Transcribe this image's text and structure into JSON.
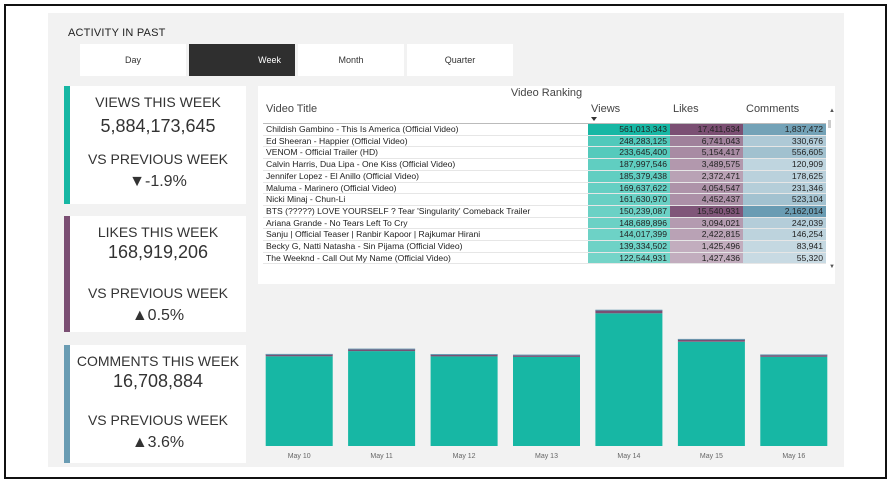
{
  "header": {
    "title": "ACTIVITY IN PAST"
  },
  "tabs": [
    {
      "label": "Day",
      "active": false
    },
    {
      "label": "Week",
      "active": true
    },
    {
      "label": "Month",
      "active": false
    },
    {
      "label": "Quarter",
      "active": false
    }
  ],
  "kpis": {
    "views": {
      "title": "VIEWS THIS WEEK",
      "value": "5,884,173,645",
      "compare_label": "VS PREVIOUS WEEK",
      "change": "▼-1.9%",
      "color": "#17b7a4"
    },
    "likes": {
      "title": "LIKES THIS WEEK",
      "value": "168,919,206",
      "compare_label": "VS PREVIOUS WEEK",
      "change": "▲0.5%",
      "color": "#7b4f73"
    },
    "comments": {
      "title": "COMMENTS THIS WEEK",
      "value": "16,708,884",
      "compare_label": "VS PREVIOUS WEEK",
      "change": "▲3.6%",
      "color": "#6a9cb3"
    }
  },
  "ranking": {
    "title": "Video Ranking",
    "columns": [
      "Video Title",
      "Views",
      "Likes",
      "Comments"
    ],
    "rows": [
      {
        "title": "Childish Gambino - This Is America (Official Video)",
        "views": "561,013,343",
        "likes": "17,411,634",
        "comments": "1,837,472"
      },
      {
        "title": "Ed Sheeran - Happier (Official Video)",
        "views": "248,283,125",
        "likes": "6,741,043",
        "comments": "330,676"
      },
      {
        "title": "VENOM - Official Trailer (HD)",
        "views": "233,645,400",
        "likes": "5,154,417",
        "comments": "556,605"
      },
      {
        "title": "Calvin Harris, Dua Lipa - One Kiss (Official Video)",
        "views": "187,997,546",
        "likes": "3,489,575",
        "comments": "120,909"
      },
      {
        "title": "Jennifer Lopez - El Anillo (Official Video)",
        "views": "185,379,438",
        "likes": "2,372,471",
        "comments": "178,625"
      },
      {
        "title": "Maluma - Marinero (Official Video)",
        "views": "169,637,622",
        "likes": "4,054,547",
        "comments": "231,346"
      },
      {
        "title": "Nicki Minaj - Chun-Li",
        "views": "161,630,970",
        "likes": "4,452,437",
        "comments": "523,104"
      },
      {
        "title": "BTS (?????) LOVE YOURSELF ? Tear 'Singularity' Comeback Trailer",
        "views": "150,239,087",
        "likes": "15,540,931",
        "comments": "2,162,014"
      },
      {
        "title": "Ariana Grande - No Tears Left To Cry",
        "views": "148,689,896",
        "likes": "3,094,021",
        "comments": "242,039"
      },
      {
        "title": "Sanju | Official Teaser | Ranbir Kapoor | Rajkumar Hirani",
        "views": "144,017,399",
        "likes": "2,422,815",
        "comments": "146,254"
      },
      {
        "title": "Becky G, Natti Natasha - Sin Pijama (Official Video)",
        "views": "139,334,502",
        "likes": "1,425,496",
        "comments": "83,941"
      },
      {
        "title": "The Weeknd - Call Out My Name (Official Video)",
        "views": "122,544,931",
        "likes": "1,427,436",
        "comments": "55,320"
      }
    ]
  },
  "colors": {
    "teal": "#17b7a4",
    "purple": "#7b4f73",
    "blue": "#6a9cb3"
  },
  "icons": {
    "scroll_up": "▲",
    "scroll_down": "▼"
  },
  "chart_data": {
    "type": "bar",
    "stacked": true,
    "categories": [
      "May 10",
      "May 11",
      "May 12",
      "May 13",
      "May 14",
      "May 15",
      "May 16"
    ],
    "series": [
      {
        "values": [
          845,
          894,
          844,
          839,
          1250,
          982,
          840
        ],
        "color": "#17b7a4"
      },
      {
        "values": [
          20,
          21,
          20,
          19,
          30,
          24,
          20
        ],
        "color": "#7b4f73"
      },
      {
        "values": [
          3,
          3,
          3,
          3,
          4,
          3,
          3
        ],
        "color": "#6a9cb3"
      }
    ],
    "ylim": [
      0,
      1300
    ],
    "grid": false,
    "legend": "none"
  }
}
